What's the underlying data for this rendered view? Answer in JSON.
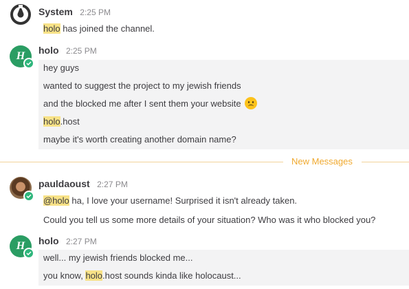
{
  "posts": [
    {
      "author": "System",
      "time": "2:25 PM",
      "lines": [
        {
          "mention": "holo",
          "rest": " has joined the channel."
        }
      ]
    },
    {
      "author": "holo",
      "time": "2:25 PM",
      "avatar_letter": "H",
      "lines": [
        {
          "text": "hey guys"
        },
        {
          "text": "wanted to suggest the project to my jewish friends"
        },
        {
          "text": "and the blocked me after I sent them your website",
          "emoji": "🙁"
        },
        {
          "mention": "holo",
          "rest": ".host"
        },
        {
          "text": "maybe it's worth creating another domain name?"
        }
      ]
    },
    {
      "author": "pauldaoust",
      "time": "2:27 PM",
      "lines": [
        {
          "mention": "@holo",
          "rest": " ha, I love your username! Surprised it isn't already taken."
        },
        {
          "text": "Could you tell us some more details of your situation? Who was it who blocked you?"
        }
      ]
    },
    {
      "author": "holo",
      "time": "2:27 PM",
      "avatar_letter": "H",
      "lines": [
        {
          "text": "well... my jewish friends blocked me..."
        },
        {
          "prefix": "you know, ",
          "mention": "holo",
          "rest": ".host sounds kinda like holocaust..."
        }
      ]
    }
  ],
  "separator": {
    "label": "New Messages"
  },
  "colors": {
    "highlight": "#f8e287",
    "status_online": "#2fb67c",
    "holo_avatar": "#2a9d63",
    "new_messages": "#f0a92f"
  }
}
